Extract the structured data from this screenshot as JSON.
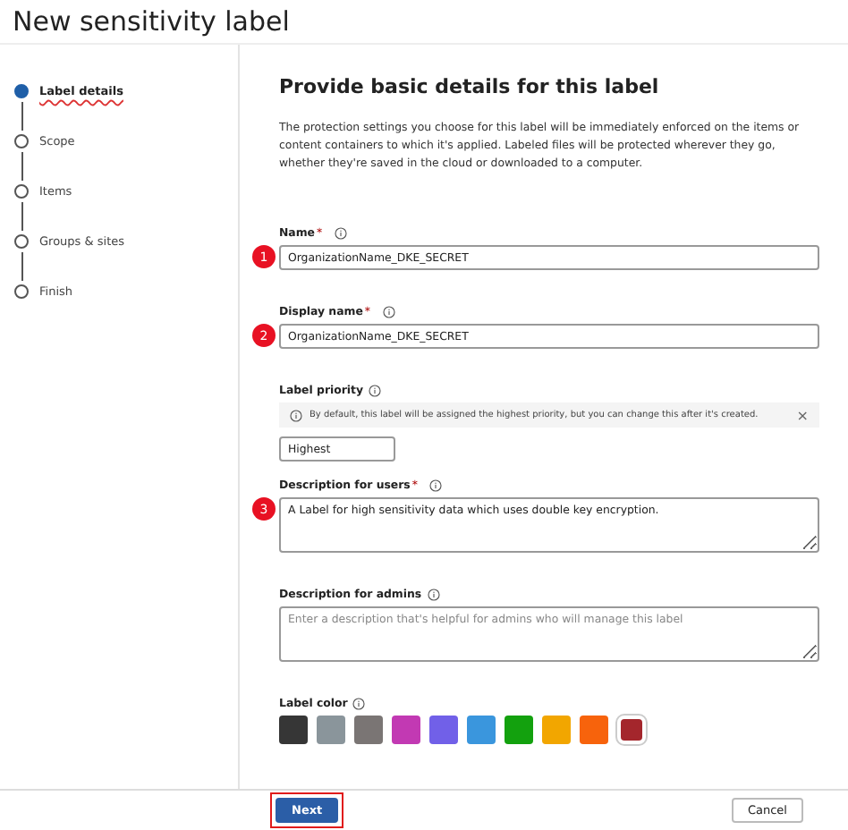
{
  "window": {
    "title": "New sensitivity label"
  },
  "steps": [
    {
      "label": "Label details",
      "selected": true
    },
    {
      "label": "Scope",
      "selected": false
    },
    {
      "label": "Items",
      "selected": false
    },
    {
      "label": "Groups & sites",
      "selected": false
    },
    {
      "label": "Finish",
      "selected": false
    }
  ],
  "heading": "Provide basic details for this label",
  "intro": "The protection settings you choose for this label will be immediately enforced on the items or content containers to which it's applied. Labeled files will be protected wherever they go, whether they're saved in the cloud or downloaded to a computer.",
  "fields": [
    {
      "kind": "input",
      "label": "Name",
      "required": "*",
      "value": "OrganizationName_DKE_SECRET",
      "callout": "1"
    },
    {
      "kind": "input",
      "label": "Display name",
      "required": "*",
      "value": "OrganizationName_DKE_SECRET",
      "callout": "2"
    },
    {
      "kind": "priority",
      "label": "Label priority",
      "notice": "By default, this label will be assigned the highest priority, but you can change this after it's created.",
      "close": "×",
      "value": "Highest"
    },
    {
      "kind": "textarea",
      "label": "Description for users",
      "required": "*",
      "value": "A Label for high sensitivity data which uses double key encryption.",
      "callout": "3"
    },
    {
      "kind": "textarea",
      "label": "Description for admins",
      "placeholder": "Enter a description that's helpful for admins who will manage this label"
    }
  ],
  "label_color": {
    "label": "Label color",
    "swatches": [
      {
        "color": "#363636",
        "selected": false
      },
      {
        "color": "#8a959b",
        "selected": false
      },
      {
        "color": "#7a7574",
        "selected": false
      },
      {
        "color": "#c239b3",
        "selected": false
      },
      {
        "color": "#7160e8",
        "selected": false
      },
      {
        "color": "#3a96dd",
        "selected": false
      },
      {
        "color": "#13a10e",
        "selected": false
      },
      {
        "color": "#f2a600",
        "selected": false
      },
      {
        "color": "#f7630c",
        "selected": false
      },
      {
        "color": "#a4262c",
        "selected": true
      }
    ]
  },
  "buttons": [
    {
      "kind": "primary",
      "label": "Next",
      "highlighted": true
    },
    {
      "kind": "secondary",
      "label": "Cancel",
      "highlighted": false
    }
  ]
}
